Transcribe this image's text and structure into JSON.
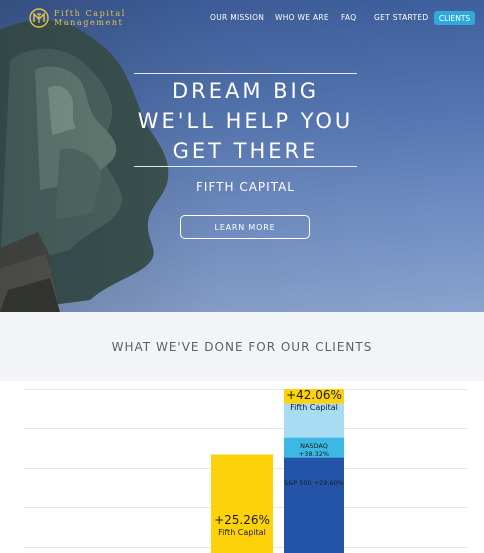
{
  "nav": {
    "logo_line1": "Fifth Capital",
    "logo_line2": "Management",
    "links": [
      "OUR MISSION",
      "WHO WE ARE",
      "FAQ",
      "GET STARTED"
    ],
    "cta": "CLIENTS"
  },
  "hero": {
    "headline_line1": "DREAM BIG",
    "headline_line2": "WE'LL HELP YOU",
    "headline_line3": "GET THERE",
    "brand": "FIFTH CAPITAL",
    "button": "LEARN MORE"
  },
  "section": {
    "title": "WHAT WE'VE DONE FOR OUR CLIENTS"
  },
  "chart_data": {
    "type": "bar",
    "categories": [
      "",
      ""
    ],
    "series": [
      {
        "name": "Fifth Capital",
        "values": [
          25.26,
          42.06
        ]
      },
      {
        "name": "NASDAQ",
        "values": [
          null,
          38.32
        ]
      },
      {
        "name": "S&P 500",
        "values": [
          null,
          29.6
        ]
      }
    ],
    "labels": {
      "fc_left_value": "+25.26%",
      "fc_left_name": "Fifth Capital",
      "fc_right_value": "+42.06%",
      "fc_right_name": "Fifth Capital",
      "nasdaq": "NASDAQ +38.32%",
      "sp500": "S&P 500 +29.60%"
    },
    "colors": {
      "fifth_capital": "#fdd20a",
      "nasdaq": "#a7dcf3",
      "sp500_band": "#3db8e4",
      "sp500": "#2454a8"
    }
  }
}
